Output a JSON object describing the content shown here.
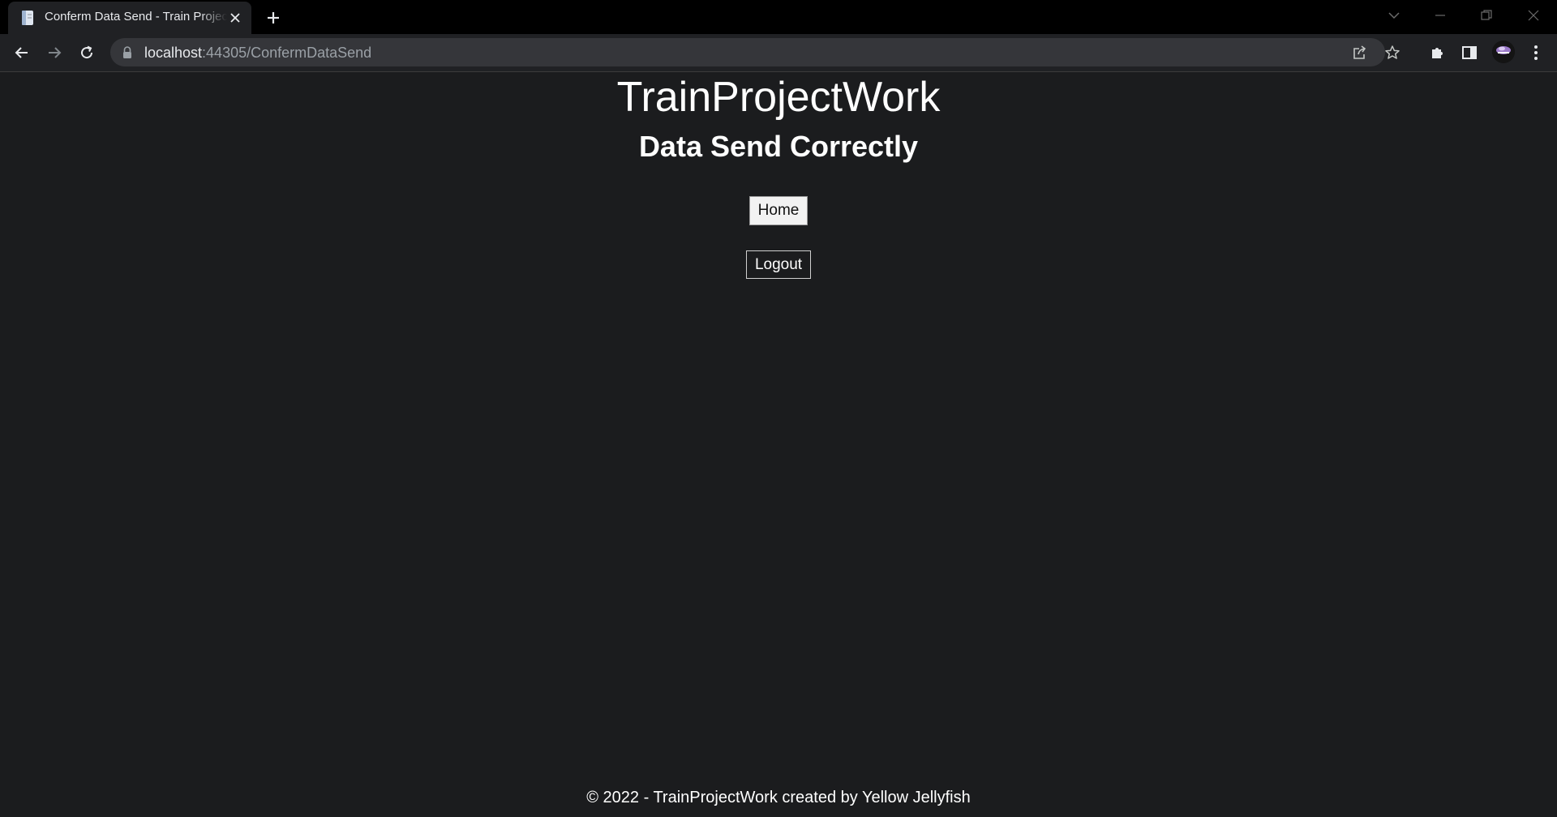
{
  "browser": {
    "tab": {
      "title": "Conferm Data Send - Train Project",
      "favicon": "page-icon"
    },
    "address": {
      "host": "localhost",
      "rest": ":44305/ConfermDataSend"
    }
  },
  "page": {
    "site_title": "TrainProjectWork",
    "heading": "Data Send Correctly",
    "home_button": "Home",
    "logout_button": "Logout",
    "footer": "© 2022 - TrainProjectWork created by Yellow Jellyfish"
  },
  "colors": {
    "page_background": "#1b1c1e",
    "text": "#ffffff",
    "home_button_bg": "#f2f2f2"
  }
}
